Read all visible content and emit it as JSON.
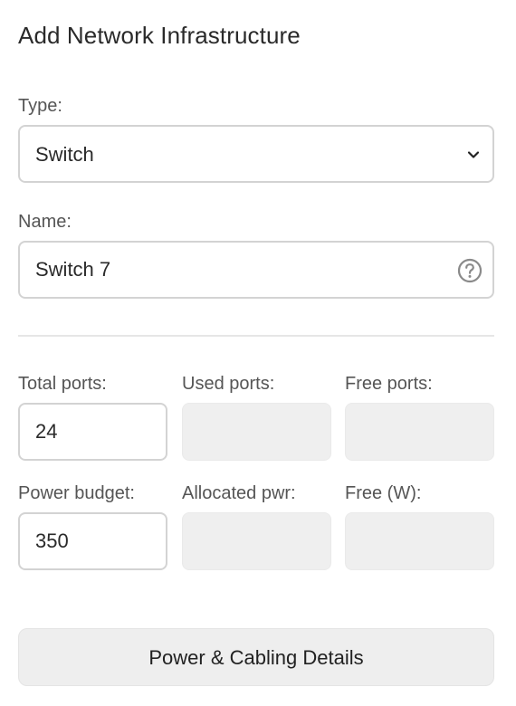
{
  "form": {
    "title": "Add Network Infrastructure",
    "type": {
      "label": "Type:",
      "value": "Switch"
    },
    "name": {
      "label": "Name:",
      "value": "Switch 7",
      "help_icon": "question-circle-icon"
    },
    "ports": {
      "total_label": "Total ports:",
      "total_value": "24",
      "used_label": "Used ports:",
      "used_value": "",
      "free_label": "Free ports:",
      "free_value": ""
    },
    "power": {
      "budget_label": "Power budget:",
      "budget_value": "350",
      "allocated_label": "Allocated pwr:",
      "allocated_value": "",
      "free_label": "Free (W):",
      "free_value": ""
    },
    "details_button_label": "Power & Cabling Details"
  },
  "colors": {
    "border": "#d3d3d3",
    "readonly_bg": "#efefef",
    "button_bg": "#eeeeee",
    "label_text": "#555555"
  }
}
